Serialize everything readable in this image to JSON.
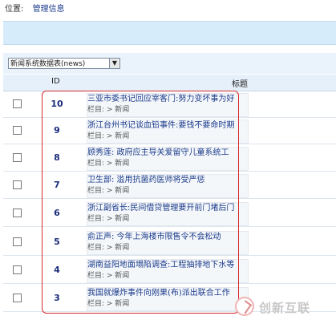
{
  "location": {
    "label": "位置:",
    "value": "管理信息"
  },
  "select": {
    "value": "新闻系统数据表(news)"
  },
  "table": {
    "headers": {
      "id": "ID",
      "title": "标题"
    },
    "rows": [
      {
        "id": "10",
        "title": "三亚市委书记回应宰客门:努力变坏事为好",
        "category": "栏目: > 新闻"
      },
      {
        "id": "9",
        "title": "浙江台州书记谈血铅事件:要钱不要命时期",
        "category": "栏目: > 新闻"
      },
      {
        "id": "8",
        "title": "顾秀莲: 政府应主导关爱留守儿童系统工",
        "category": "栏目: > 新闻"
      },
      {
        "id": "7",
        "title": "卫生部: 滥用抗菌药医师将受严惩",
        "category": "栏目: > 新闻"
      },
      {
        "id": "6",
        "title": "浙江副省长:民间借贷管理要开前门堵后门",
        "category": "栏目: > 新闻"
      },
      {
        "id": "5",
        "title": "俞正声: 今年上海楼市限售令不会松动",
        "category": "栏目: > 新闻"
      },
      {
        "id": "4",
        "title": "湖南益阳地面塌陷调查:工程抽排地下水等",
        "category": "栏目: > 新闻"
      },
      {
        "id": "3",
        "title": "我国就爆炸事件向刚果(布)派出联合工作",
        "category": "栏目: > 新闻"
      }
    ]
  },
  "watermark": {
    "text": "创新互联"
  }
}
